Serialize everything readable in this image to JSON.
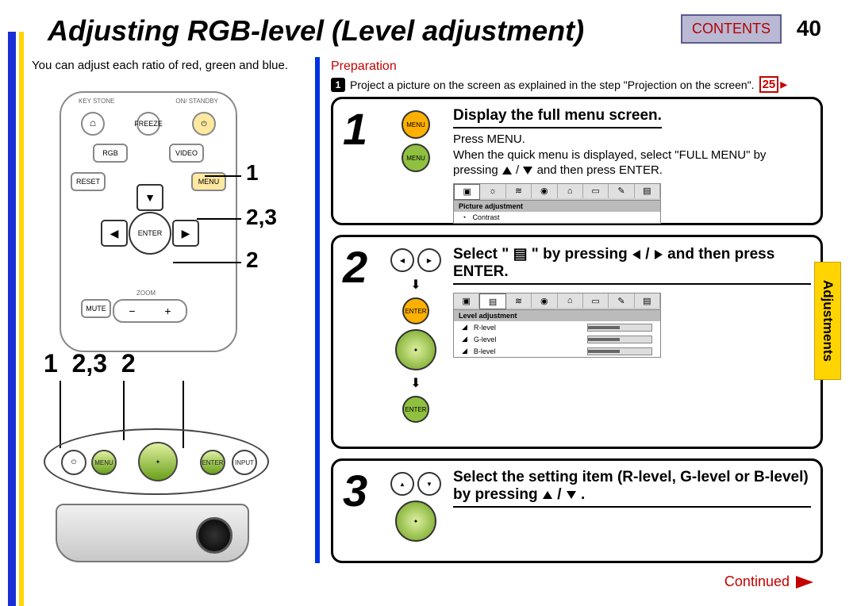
{
  "title": "Adjusting RGB-level (Level adjustment)",
  "contents_label": "CONTENTS",
  "page_number": "40",
  "intro_text": "You can adjust each ratio of red, green and blue.",
  "preparation_label": "Preparation",
  "preparation_text": "Project a picture on the screen as explained in the step \"Projection on the screen\".",
  "preparation_ref": "25",
  "side_tab": "Adjustments",
  "continued_label": "Continued",
  "remote": {
    "keys": {
      "keystone": "KEY\nSTONE",
      "standby": "ON/\nSTANDBY",
      "freeze": "FREEZE",
      "rgb": "RGB",
      "video": "VIDEO",
      "reset": "RESET",
      "menu": "MENU",
      "enter": "ENTER",
      "mute": "MUTE",
      "vol_minus": "VOL−",
      "vol_plus": "VOL+",
      "zoom": "ZOOM"
    }
  },
  "remote_pointers": {
    "p1": "1",
    "p23": "2,3",
    "p2": "2"
  },
  "oval_labels": {
    "l1": "1",
    "l23": "2,3",
    "l2": "2"
  },
  "oval_btn": {
    "menu": "MENU",
    "enter": "ENTER",
    "input": "INPUT"
  },
  "steps": [
    {
      "num": "1",
      "icon_labels": {
        "menu": "MENU"
      },
      "title": "Display the full menu screen.",
      "line1": "Press MENU.",
      "line2a": "When the quick menu is displayed, select \"FULL MENU\" by pressing ",
      "line2b": " / ",
      "line2c": " and then press ENTER.",
      "osd_head": "Picture adjustment",
      "osd_row1": "Contrast"
    },
    {
      "num": "2",
      "icon_labels": {
        "enter": "ENTER"
      },
      "title_a": "Select \"",
      "title_b": "\" by pressing ",
      "title_c": " / ",
      "title_d": " and then press ENTER.",
      "osd_head": "Level adjustment",
      "osd_rows": [
        "R-level",
        "G-level",
        "B-level"
      ]
    },
    {
      "num": "3",
      "title_a": "Select the setting item (R-level, G-level or B-level) by pressing ",
      "title_b": " / ",
      "title_c": "."
    }
  ]
}
